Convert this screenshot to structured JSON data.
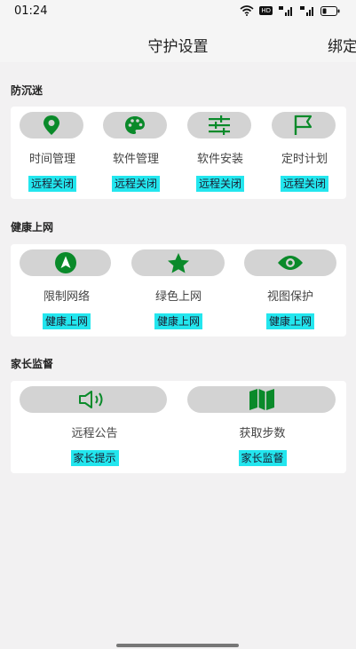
{
  "status": {
    "time": "01:24",
    "hd": "HD"
  },
  "header": {
    "title": "守护设置",
    "bind_link": "绑定"
  },
  "sections": [
    {
      "title": "防沉迷",
      "items": [
        {
          "label": "时间管理",
          "badge": "远程关闭",
          "icon": "location-pin-icon"
        },
        {
          "label": "软件管理",
          "badge": "远程关闭",
          "icon": "palette-icon"
        },
        {
          "label": "软件安装",
          "badge": "远程关闭",
          "icon": "sliders-icon"
        },
        {
          "label": "定时计划",
          "badge": "远程关闭",
          "icon": "flag-icon"
        }
      ]
    },
    {
      "title": "健康上网",
      "items": [
        {
          "label": "限制网络",
          "badge": "健康上网",
          "icon": "navigation-arrow-icon"
        },
        {
          "label": "绿色上网",
          "badge": "健康上网",
          "icon": "star-icon"
        },
        {
          "label": "视图保护",
          "badge": "健康上网",
          "icon": "eye-icon"
        }
      ]
    },
    {
      "title": "家长监督",
      "items": [
        {
          "label": "远程公告",
          "badge": "家长提示",
          "icon": "speaker-icon"
        },
        {
          "label": "获取步数",
          "badge": "家长监督",
          "icon": "map-icon"
        }
      ]
    }
  ],
  "colors": {
    "accent_green": "#0a8a2a",
    "badge_cyan": "#23e6ee",
    "pill_gray": "#d3d3d3"
  }
}
